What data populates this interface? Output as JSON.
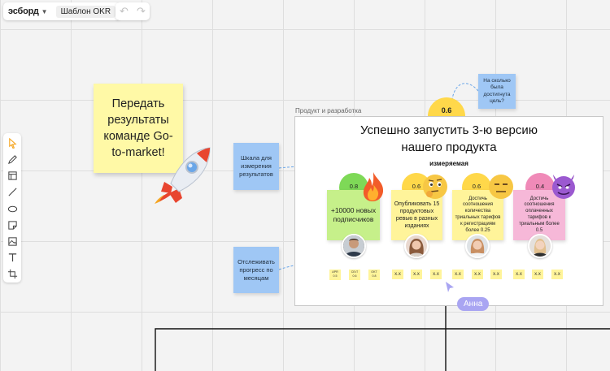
{
  "topbar": {
    "logo": "эсборд",
    "board_name": "Шаблон OKR"
  },
  "toolbar": {
    "tools": [
      "select-tool",
      "pen-tool",
      "frame-tool",
      "line-tool",
      "shape-tool",
      "sticky-tool",
      "image-tool",
      "text-tool",
      "more-tool"
    ]
  },
  "canvas": {
    "main_sticky": "Передать результаты команде Go-to-market!",
    "note_scale": "Шкала для измерения результатов",
    "note_progress": "Отслеживать прогресс по месяцам",
    "note_question": "На сколько была достигнута цель?",
    "top_score": "0.6",
    "frame_label": "Продукт и разработка",
    "objective_line1": "Успешно запустить 3-ю версию",
    "objective_line2": "нашего продукта",
    "objective_sub": "измеряемая",
    "key_results": [
      {
        "score": "0.8",
        "text": "+10000 новых подписчиков",
        "color": "#c6f08a",
        "circle": "#7ed957"
      },
      {
        "score": "0.6",
        "text": "Опубликовать 15 продуктовых ревью в разных изданиях",
        "color": "#fff49a",
        "circle": "#ffd84a"
      },
      {
        "score": "0.6",
        "text": "Достичь соотношения количества триальных тарифов к регистрациям более 0.25",
        "color": "#fff49a",
        "circle": "#ffd84a"
      },
      {
        "score": "0.4",
        "text": "Достичь соотношения оплаченных тарифов к триальным более 0.5",
        "color": "#f6b8d8",
        "circle": "#f08ab8"
      }
    ],
    "month_cells_first": [
      {
        "top": "APR",
        "bottom": "0.5"
      },
      {
        "top": "CE•T",
        "bottom": "0.6"
      },
      {
        "top": "OKT",
        "bottom": "0.8"
      }
    ],
    "month_cells_rest": [
      "x.x",
      "x.x",
      "x.x",
      "x.x",
      "x.x",
      "x.x",
      "x.x",
      "x.x",
      "x.x"
    ],
    "cursor_user": "Анна"
  },
  "colors": {
    "accent": "#f5a623",
    "sticky_blue": "#9fc7f5",
    "cursor": "#a9a5f2"
  }
}
